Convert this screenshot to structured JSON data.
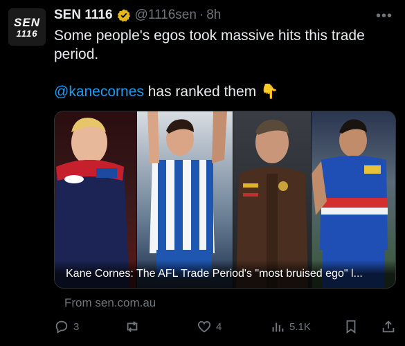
{
  "author": {
    "avatar_text_line1": "SEN",
    "avatar_text_line2": "1116",
    "name": "SEN 1116",
    "handle": "@1116sen",
    "time": "8h",
    "verified_icon": "gold-verified-badge-icon"
  },
  "tweet": {
    "line1": "Some people's egos took massive hits this trade period.",
    "mention": "@kanecornes",
    "line2_rest": " has ranked them ",
    "emoji": "👇"
  },
  "card": {
    "caption": "Kane Cornes: The AFL Trade Period's \"most bruised ego\" l...",
    "source": "From sen.com.au"
  },
  "actions": {
    "replies": "3",
    "retweets": "",
    "likes": "4",
    "views": "5.1K"
  },
  "colors": {
    "background": "#000000",
    "text": "#e7e9ea",
    "muted": "#71767b",
    "link": "#1d9bf0",
    "verified": "#e2b719"
  }
}
